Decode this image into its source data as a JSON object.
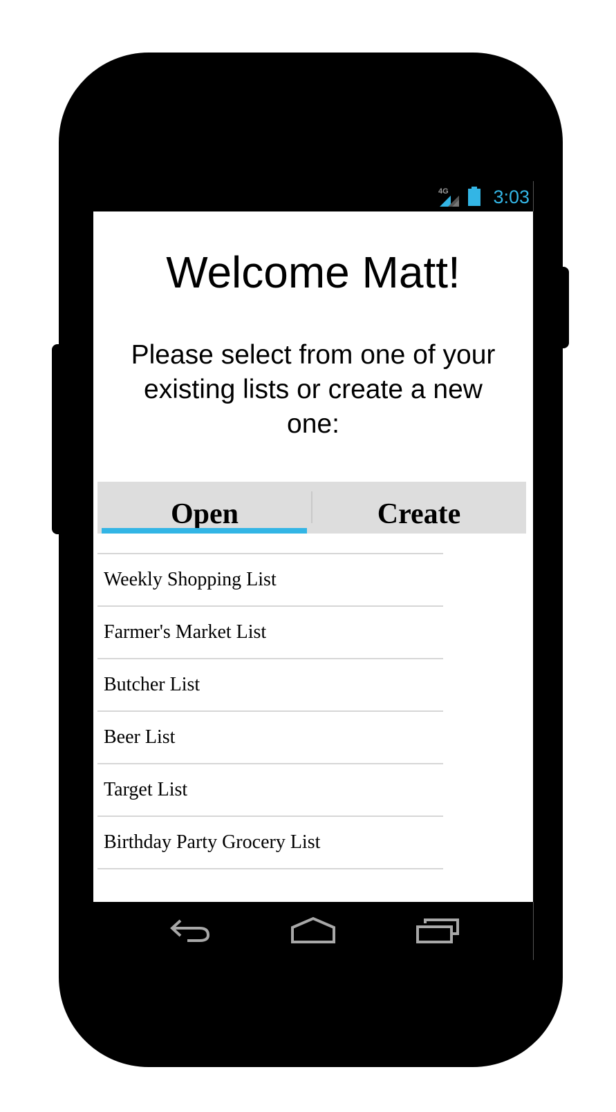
{
  "status_bar": {
    "network_label": "4G",
    "time": "3:03",
    "accent_color": "#33b5e5"
  },
  "screen": {
    "welcome": "Welcome Matt!",
    "instructions": "Please select from one of your existing lists or create a new one:"
  },
  "tabs": {
    "selected": "Open",
    "items": [
      {
        "label": "Open"
      },
      {
        "label": "Create"
      }
    ]
  },
  "lists": [
    {
      "label": "Weekly Shopping List"
    },
    {
      "label": "Farmer's Market List"
    },
    {
      "label": "Butcher List"
    },
    {
      "label": "Beer List"
    },
    {
      "label": "Target List"
    },
    {
      "label": "Birthday Party Grocery List"
    }
  ],
  "nav_bar": {
    "icons": [
      "back-icon",
      "home-icon",
      "recents-icon"
    ]
  }
}
